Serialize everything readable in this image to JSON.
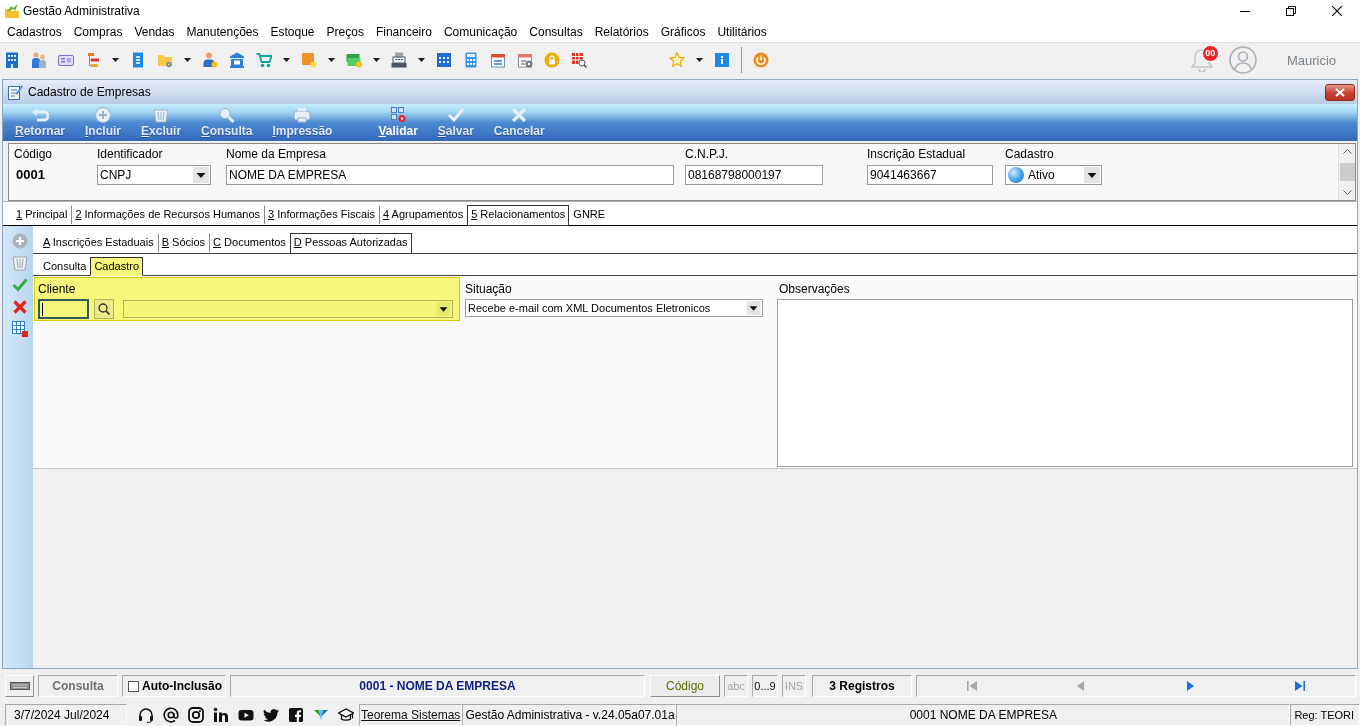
{
  "window": {
    "title": "Gestão Administrativa"
  },
  "menu": [
    "Cadastros",
    "Compras",
    "Vendas",
    "Manutenções",
    "Estoque",
    "Preços",
    "Financeiro",
    "Comunicação",
    "Consultas",
    "Relatórios",
    "Gráficos",
    "Utilitários"
  ],
  "user": {
    "notifications": "00",
    "name": "Mauricio"
  },
  "form": {
    "title": "Cadastro de Empresas",
    "toolbar": [
      {
        "label": "Retornar",
        "hotkey": true,
        "disabled": true
      },
      {
        "label": "Incluir",
        "hotkey": true,
        "disabled": true
      },
      {
        "label": "Excluir",
        "hotkey": true,
        "disabled": true
      },
      {
        "label": "Consulta",
        "hotkey": true,
        "disabled": true
      },
      {
        "label": "Impressão",
        "hotkey": true,
        "disabled": true
      },
      {
        "label": "Validar",
        "hotkey": true,
        "disabled": false
      },
      {
        "label": "Salvar",
        "hotkey": true,
        "disabled": true
      },
      {
        "label": "Cancelar",
        "hotkey": false,
        "disabled": true
      }
    ],
    "header": [
      {
        "kind": "display",
        "label": "Código",
        "value": "0001"
      },
      {
        "kind": "select",
        "label": "Identificador",
        "value": "CNPJ"
      },
      {
        "kind": "input",
        "label": "Nome da Empresa",
        "value": "NOME DA EMPRESA"
      },
      {
        "kind": "input",
        "label": "C.N.P.J.",
        "value": "08168798000197"
      },
      {
        "kind": "input",
        "label": "Inscrição Estadual",
        "value": "9041463667"
      },
      {
        "kind": "status",
        "label": "Cadastro",
        "value": "Ativo"
      }
    ],
    "tabs": [
      {
        "label": "1 Principal",
        "hotkey": true,
        "selected": false
      },
      {
        "label": "2 Informações de Recursos Humanos",
        "hotkey": true,
        "selected": false
      },
      {
        "label": "3 Informações Fiscais",
        "hotkey": true,
        "selected": false
      },
      {
        "label": "4 Agrupamentos",
        "hotkey": true,
        "selected": false
      },
      {
        "label": "5 Relacionamentos",
        "hotkey": true,
        "selected": true
      },
      {
        "label": "GNRE",
        "hotkey": false,
        "selected": false
      }
    ],
    "side_toolbar": [
      {
        "disabled": true
      },
      {
        "disabled": true
      },
      {
        "disabled": false
      },
      {
        "disabled": false
      },
      {
        "disabled": false
      }
    ],
    "subtabs": [
      {
        "label": "A Inscrições Estaduais",
        "hotkey": true,
        "selected": false
      },
      {
        "label": "B Sócios",
        "hotkey": true,
        "selected": false
      },
      {
        "label": "C Documentos",
        "hotkey": true,
        "selected": false
      },
      {
        "label": "D Pessoas Autorizadas",
        "hotkey": true,
        "selected": true
      }
    ],
    "view_tabs": [
      {
        "label": "Consulta",
        "selected": false
      },
      {
        "label": "Cadastro",
        "selected": true
      }
    ],
    "cliente": {
      "label": "Cliente",
      "focused": true
    },
    "situacao": {
      "label": "Situação",
      "value": "Recebe e-mail com XML Documentos Eletronicos"
    },
    "observacoes": {
      "label": "Observações"
    }
  },
  "status_bar": {
    "mode": "Consulta",
    "auto_inclusion": {
      "label": "Auto-Inclusão",
      "checked": false
    },
    "record": "0001 - NOME DA EMPRESA",
    "sort_field": "Código",
    "indicators": [
      {
        "label": "abc",
        "on": false
      },
      {
        "label": "0...9",
        "on": true
      },
      {
        "label": "INS",
        "on": false
      }
    ],
    "count": "3 Registros",
    "navigation": [
      {
        "disabled": true
      },
      {
        "disabled": true
      },
      {
        "disabled": false
      },
      {
        "disabled": false
      }
    ]
  },
  "footer": {
    "date": "3/7/2024 Jul/2024",
    "link": "Teorema Sistemas",
    "version": "Gestão Administrativa - v.24.05a07.01a",
    "company": "0001 NOME DA EMPRESA",
    "registration": "Reg: TEORI"
  }
}
